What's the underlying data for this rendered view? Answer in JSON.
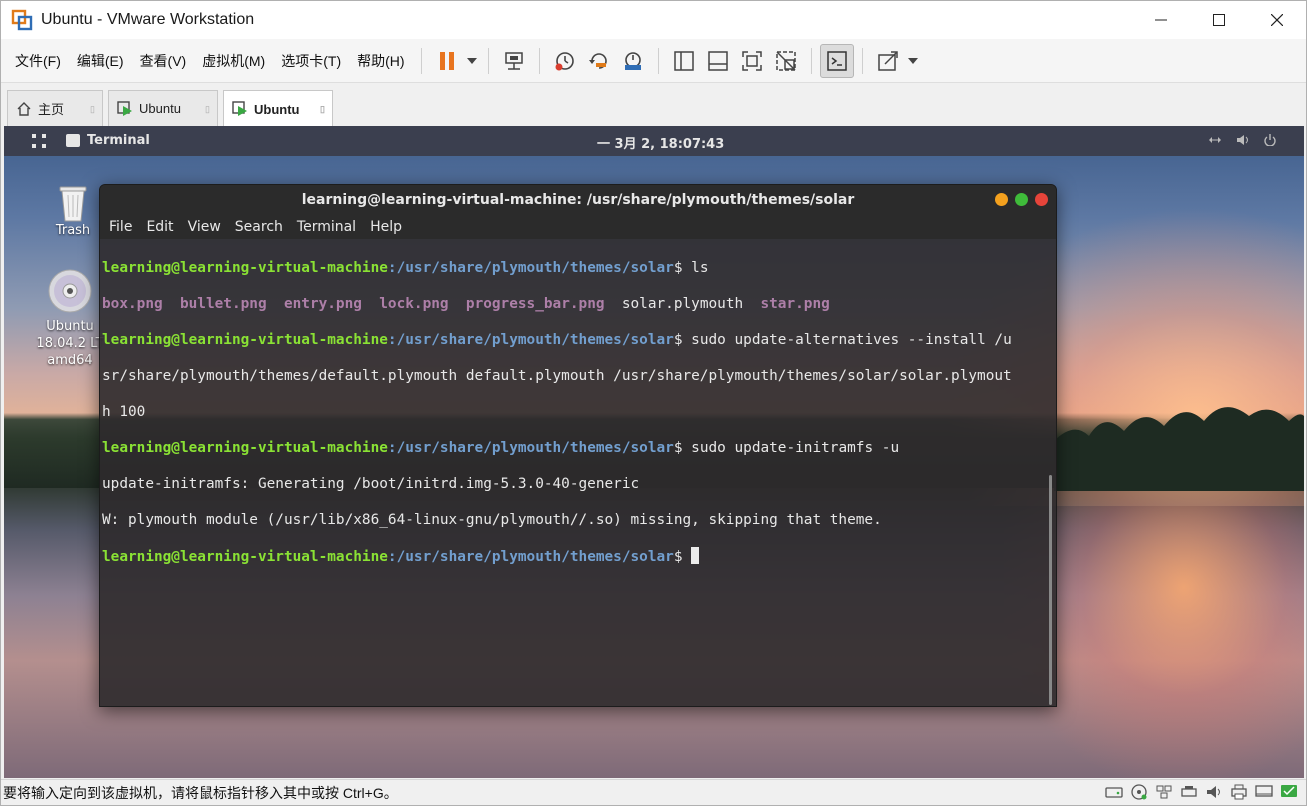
{
  "window": {
    "title": "Ubuntu - VMware Workstation"
  },
  "menu": {
    "items": [
      "文件(F)",
      "编辑(E)",
      "查看(V)",
      "虚拟机(M)",
      "选项卡(T)",
      "帮助(H)"
    ]
  },
  "tabs": [
    {
      "label": "主页",
      "icon": "home-icon",
      "active": false
    },
    {
      "label": "Ubuntu",
      "icon": "vm-play-icon",
      "active": false
    },
    {
      "label": "Ubuntu",
      "icon": "vm-play-icon",
      "active": true
    }
  ],
  "gnome": {
    "activity": "Terminal",
    "clock": "一 3月  2, 18:07:43"
  },
  "desktop": {
    "trash_label": "Trash",
    "dvd_label_1": "Ubuntu",
    "dvd_label_2": "18.04.2 LT",
    "dvd_label_3": "amd64"
  },
  "terminal": {
    "title": "learning@learning-virtual-machine: /usr/share/plymouth/themes/solar",
    "menu": [
      "File",
      "Edit",
      "View",
      "Search",
      "Terminal",
      "Help"
    ],
    "prompt_user": "learning@learning-virtual-machine",
    "prompt_path": ":/usr/share/plymouth/themes/solar",
    "cmd1": "$ ls",
    "ls_files": [
      "box.png",
      "bullet.png",
      "entry.png",
      "lock.png",
      "progress_bar.png"
    ],
    "ls_plain": "solar.plymouth",
    "ls_last": "star.png",
    "cmd2_a": "$ sudo update-alternatives --install /u",
    "cmd2_b": "sr/share/plymouth/themes/default.plymouth default.plymouth /usr/share/plymouth/themes/solar/solar.plymout",
    "cmd2_c": "h 100",
    "cmd3": "$ sudo update-initramfs -u",
    "out3_a": "update-initramfs: Generating /boot/initrd.img-5.3.0-40-generic",
    "out3_b": "W: plymouth module (/usr/lib/x86_64-linux-gnu/plymouth//.so) missing, skipping that theme.",
    "cmd4": "$ "
  },
  "status": {
    "text": "要将输入定向到该虚拟机，请将鼠标指针移入其中或按 Ctrl+G。"
  },
  "colors": {
    "prompt_user": "#8ae234",
    "prompt_path": "#729fcf",
    "image_files": "#ad7fa8",
    "pause_icon": "#e8741e"
  }
}
